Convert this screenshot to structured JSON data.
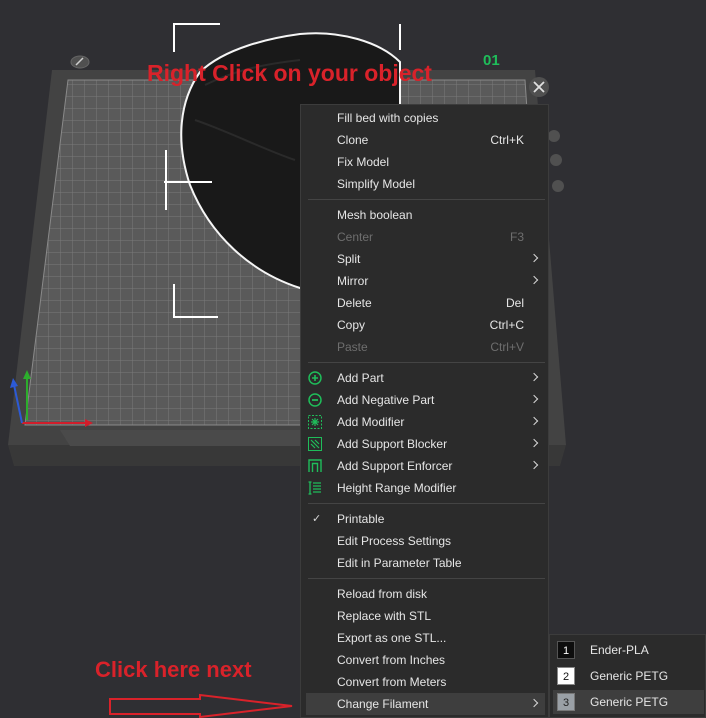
{
  "annotations": {
    "right_click": "Right Click on your object",
    "click_next": "Click here next"
  },
  "plate": {
    "number": "01"
  },
  "menu": {
    "items": [
      {
        "label": "Fill bed with copies"
      },
      {
        "label": "Clone",
        "shortcut": "Ctrl+K"
      },
      {
        "label": "Fix Model"
      },
      {
        "label": "Simplify Model"
      },
      {
        "label": "Mesh boolean"
      },
      {
        "label": "Center",
        "shortcut": "F3"
      },
      {
        "label": "Split"
      },
      {
        "label": "Mirror"
      },
      {
        "label": "Delete",
        "shortcut": "Del"
      },
      {
        "label": "Copy",
        "shortcut": "Ctrl+C"
      },
      {
        "label": "Paste",
        "shortcut": "Ctrl+V"
      },
      {
        "label": "Add Part"
      },
      {
        "label": "Add Negative Part"
      },
      {
        "label": "Add Modifier"
      },
      {
        "label": "Add Support Blocker"
      },
      {
        "label": "Add Support Enforcer"
      },
      {
        "label": "Height Range Modifier"
      },
      {
        "label": "Printable"
      },
      {
        "label": "Edit Process Settings"
      },
      {
        "label": "Edit in Parameter Table"
      },
      {
        "label": "Reload from disk"
      },
      {
        "label": "Replace with STL"
      },
      {
        "label": "Export as one STL..."
      },
      {
        "label": "Convert from Inches"
      },
      {
        "label": "Convert from Meters"
      },
      {
        "label": "Change Filament"
      }
    ]
  },
  "filaments": [
    {
      "number": "1",
      "name": "Ender-PLA",
      "color": "#0d0d0d",
      "text_color": "#ffffff"
    },
    {
      "number": "2",
      "name": "Generic PETG",
      "color": "#ffffff",
      "text_color": "#111111"
    },
    {
      "number": "3",
      "name": "Generic PETG",
      "color": "#9aa0a6",
      "text_color": "#222222"
    }
  ],
  "colors": {
    "accent_green": "#1fbd5a",
    "annotation_red": "#d9222a",
    "menu_bg": "#2b2b2b"
  }
}
